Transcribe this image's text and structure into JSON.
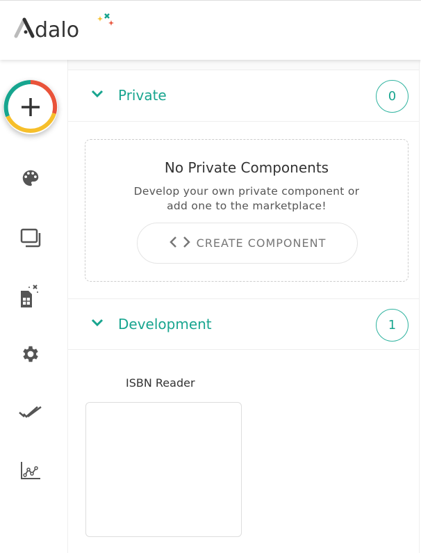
{
  "header": {
    "logo_text": "Adalo"
  },
  "sidebar": {
    "items": [
      {
        "name": "add",
        "icon": "plus-icon"
      },
      {
        "name": "branding",
        "icon": "palette-icon"
      },
      {
        "name": "screens",
        "icon": "screens-icon"
      },
      {
        "name": "database",
        "icon": "database-sparkle-icon"
      },
      {
        "name": "settings",
        "icon": "gear-icon"
      },
      {
        "name": "publish",
        "icon": "double-check-icon"
      },
      {
        "name": "analytics",
        "icon": "chart-icon"
      }
    ]
  },
  "colors": {
    "accent": "#18a58f",
    "ring_red": "#e9533a",
    "ring_yellow": "#f6bf2b",
    "ring_teal": "#17a58f"
  },
  "sections": {
    "private": {
      "title": "Private",
      "count": "0",
      "empty_title": "No Private Components",
      "empty_line1": "Develop your own private component or",
      "empty_line2": "add one to the marketplace!",
      "create_label": "CREATE COMPONENT"
    },
    "development": {
      "title": "Development",
      "count": "1",
      "components": [
        {
          "name": "ISBN Reader"
        }
      ]
    }
  }
}
